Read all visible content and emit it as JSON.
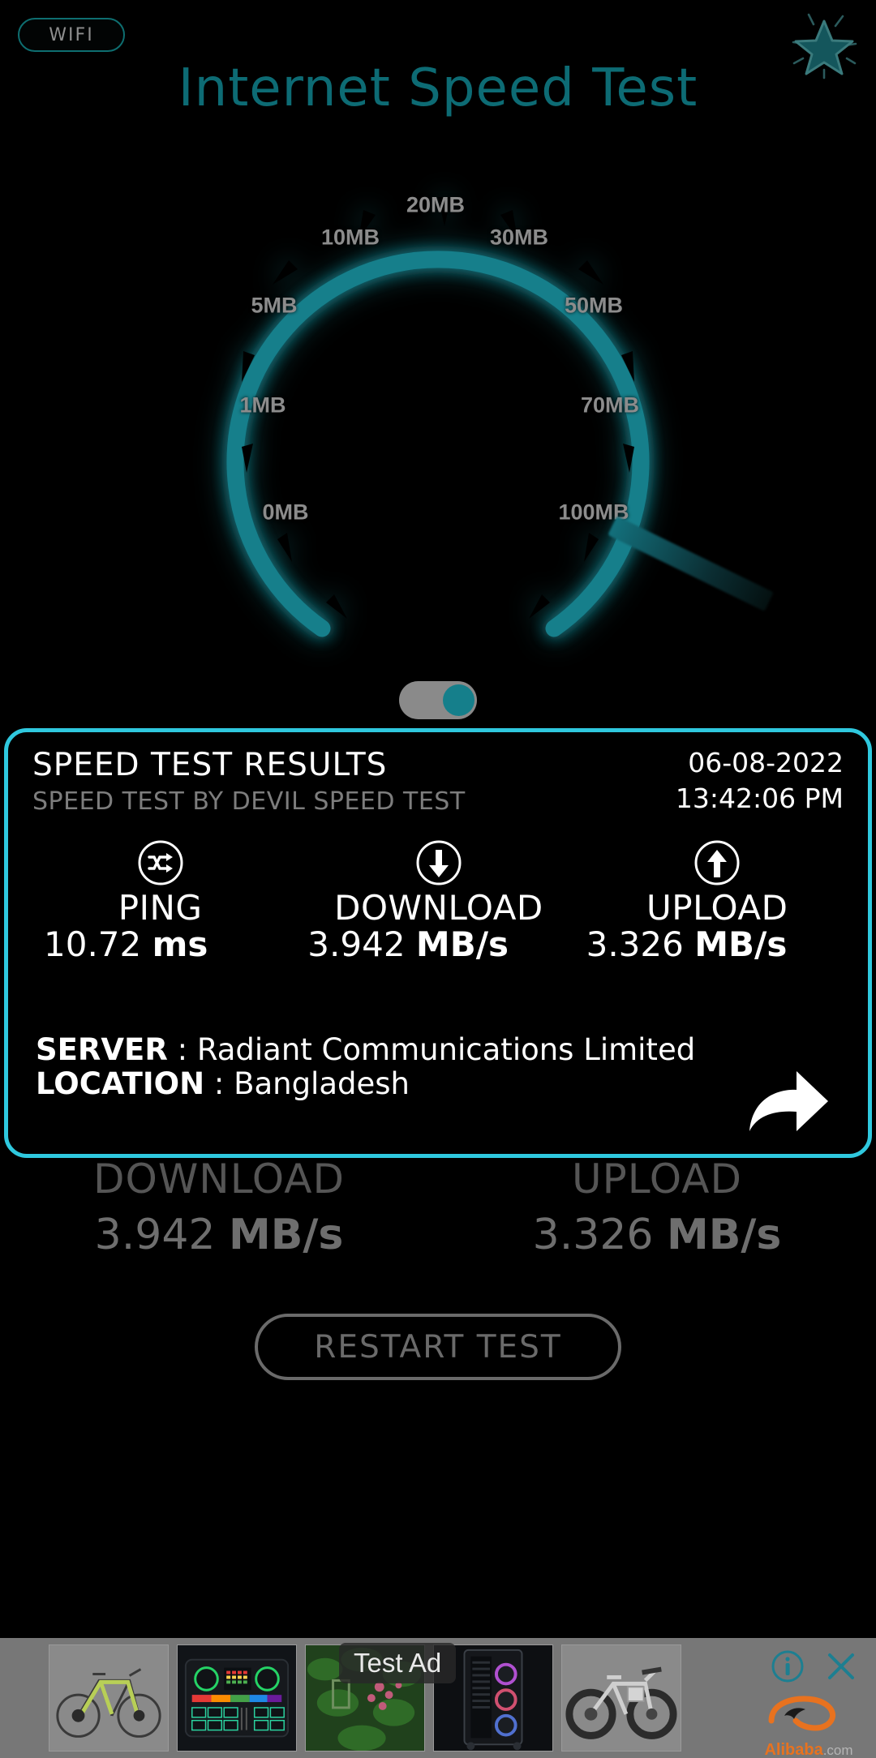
{
  "theme": {
    "background": "#000000",
    "teal": "#0d6b74",
    "cyan_border": "#2fc8de",
    "gauge_ring": "#157f8b",
    "gray_text": "#6e6e6e",
    "white": "#ffffff"
  },
  "topbar": {
    "connection_badge": "WIFI",
    "rate_icon": "star-icon"
  },
  "header": {
    "title": "Internet Speed Test"
  },
  "gauge": {
    "unit_suffix": "MB",
    "ticks": [
      {
        "label": "0MB",
        "value": 0
      },
      {
        "label": "1MB",
        "value": 1
      },
      {
        "label": "5MB",
        "value": 5
      },
      {
        "label": "10MB",
        "value": 10
      },
      {
        "label": "20MB",
        "value": 20
      },
      {
        "label": "30MB",
        "value": 30
      },
      {
        "label": "50MB",
        "value": 50
      },
      {
        "label": "70MB",
        "value": 70
      },
      {
        "label": "100MB",
        "value": 100
      }
    ],
    "toggle": {
      "name": "unit-toggle",
      "state": "on"
    }
  },
  "result_card": {
    "title": "SPEED TEST RESULTS",
    "subtitle": "SPEED TEST BY DEVIL SPEED TEST",
    "date": "06-08-2022",
    "time": "13:42:06 PM",
    "metrics": [
      {
        "icon": "shuffle-icon",
        "name": "PING",
        "value": "10.72",
        "unit": "ms"
      },
      {
        "icon": "arrow-down-icon",
        "name": "DOWNLOAD",
        "value": "3.942",
        "unit": "MB/s"
      },
      {
        "icon": "arrow-up-icon",
        "name": "UPLOAD",
        "value": "3.326",
        "unit": "MB/s"
      }
    ],
    "server_key": "SERVER",
    "server_value": "Radiant Communications Limited",
    "location_key": "LOCATION",
    "location_value": "Bangladesh",
    "share_icon": "share-arrow-icon"
  },
  "summary": {
    "download_label": "DOWNLOAD",
    "download_value": "3.942",
    "download_unit": "MB/s",
    "upload_label": "UPLOAD",
    "upload_value": "3.326",
    "upload_unit": "MB/s"
  },
  "actions": {
    "restart_label": "RESTART TEST"
  },
  "ad": {
    "label": "Test Ad",
    "brand_name": "Alibaba",
    "brand_suffix": ".com",
    "info_icon": "info-icon",
    "close_icon": "close-icon",
    "tiles": [
      {
        "name": "bicycle-green"
      },
      {
        "name": "audio-mixer"
      },
      {
        "name": "plant-wall"
      },
      {
        "name": "pc-tower"
      },
      {
        "name": "bicycle-white"
      }
    ]
  }
}
